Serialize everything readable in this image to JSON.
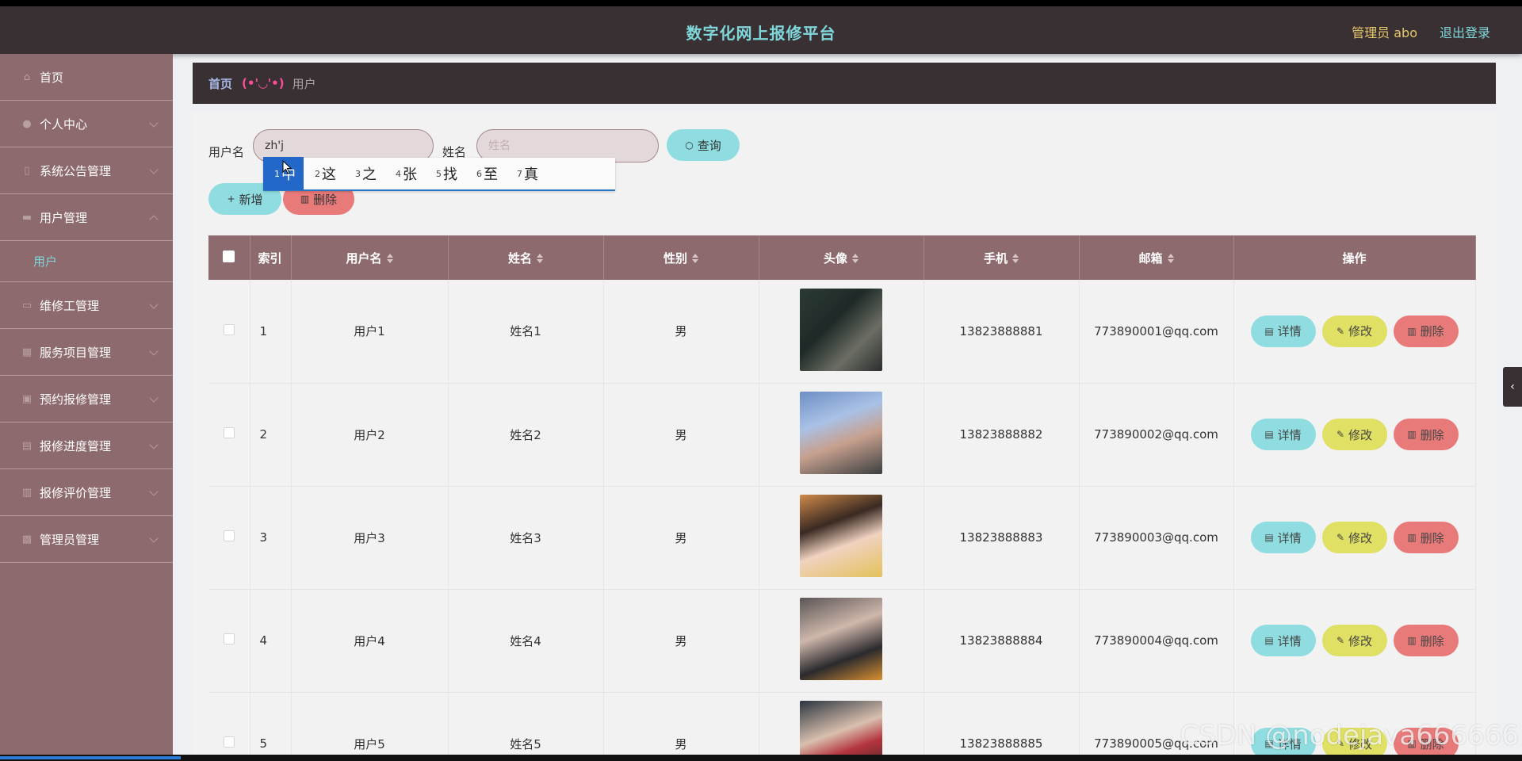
{
  "header": {
    "app_title": "数字化网上报修平台",
    "admin_label": "管理员 abo",
    "logout_label": "退出登录"
  },
  "sidebar": {
    "items": [
      {
        "label": "首页",
        "icon": "home-icon"
      },
      {
        "label": "个人中心",
        "icon": "user-icon"
      },
      {
        "label": "系统公告管理",
        "icon": "notice-icon"
      },
      {
        "label": "用户管理",
        "icon": "users-icon",
        "sub": [
          "用户"
        ]
      },
      {
        "label": "维修工管理",
        "icon": "worker-icon"
      },
      {
        "label": "服务项目管理",
        "icon": "service-icon"
      },
      {
        "label": "预约报修管理",
        "icon": "calendar-icon"
      },
      {
        "label": "报修进度管理",
        "icon": "progress-icon"
      },
      {
        "label": "报修评价管理",
        "icon": "review-icon"
      },
      {
        "label": "管理员管理",
        "icon": "admin-icon"
      }
    ]
  },
  "breadcrumb": {
    "home": "首页",
    "separator": "(•'◡'•)",
    "current": "用户"
  },
  "search": {
    "username_label": "用户名",
    "username_value": "zh'j",
    "name_label": "姓名",
    "name_placeholder": "姓名",
    "query_label": "查询",
    "add_label": "新增",
    "delete_label": "删除"
  },
  "ime": {
    "candidates": [
      {
        "num": "1",
        "text": "中"
      },
      {
        "num": "2",
        "text": "这"
      },
      {
        "num": "3",
        "text": "之"
      },
      {
        "num": "4",
        "text": "张"
      },
      {
        "num": "5",
        "text": "找"
      },
      {
        "num": "6",
        "text": "至"
      },
      {
        "num": "7",
        "text": "真"
      }
    ]
  },
  "table": {
    "columns": [
      "索引",
      "用户名",
      "姓名",
      "性别",
      "头像",
      "手机",
      "邮箱",
      "操作"
    ],
    "actions": {
      "detail": "详情",
      "edit": "修改",
      "delete": "删除"
    },
    "rows": [
      {
        "index": "1",
        "username": "用户1",
        "name": "姓名1",
        "gender": "男",
        "phone": "13823888881",
        "email": "773890001@qq.com"
      },
      {
        "index": "2",
        "username": "用户2",
        "name": "姓名2",
        "gender": "男",
        "phone": "13823888882",
        "email": "773890002@qq.com"
      },
      {
        "index": "3",
        "username": "用户3",
        "name": "姓名3",
        "gender": "男",
        "phone": "13823888883",
        "email": "773890003@qq.com"
      },
      {
        "index": "4",
        "username": "用户4",
        "name": "姓名4",
        "gender": "男",
        "phone": "13823888884",
        "email": "773890004@qq.com"
      },
      {
        "index": "5",
        "username": "用户5",
        "name": "姓名5",
        "gender": "男",
        "phone": "13823888885",
        "email": "773890005@qq.com"
      }
    ]
  },
  "watermark": "CSDN @nodejava666666",
  "colors": {
    "header_bg": "#393033",
    "sidebar_bg": "#8d6a6d",
    "accent_cyan": "#8fdde0",
    "edit_yellow": "#dfe064",
    "delete_red": "#e87a7a"
  }
}
